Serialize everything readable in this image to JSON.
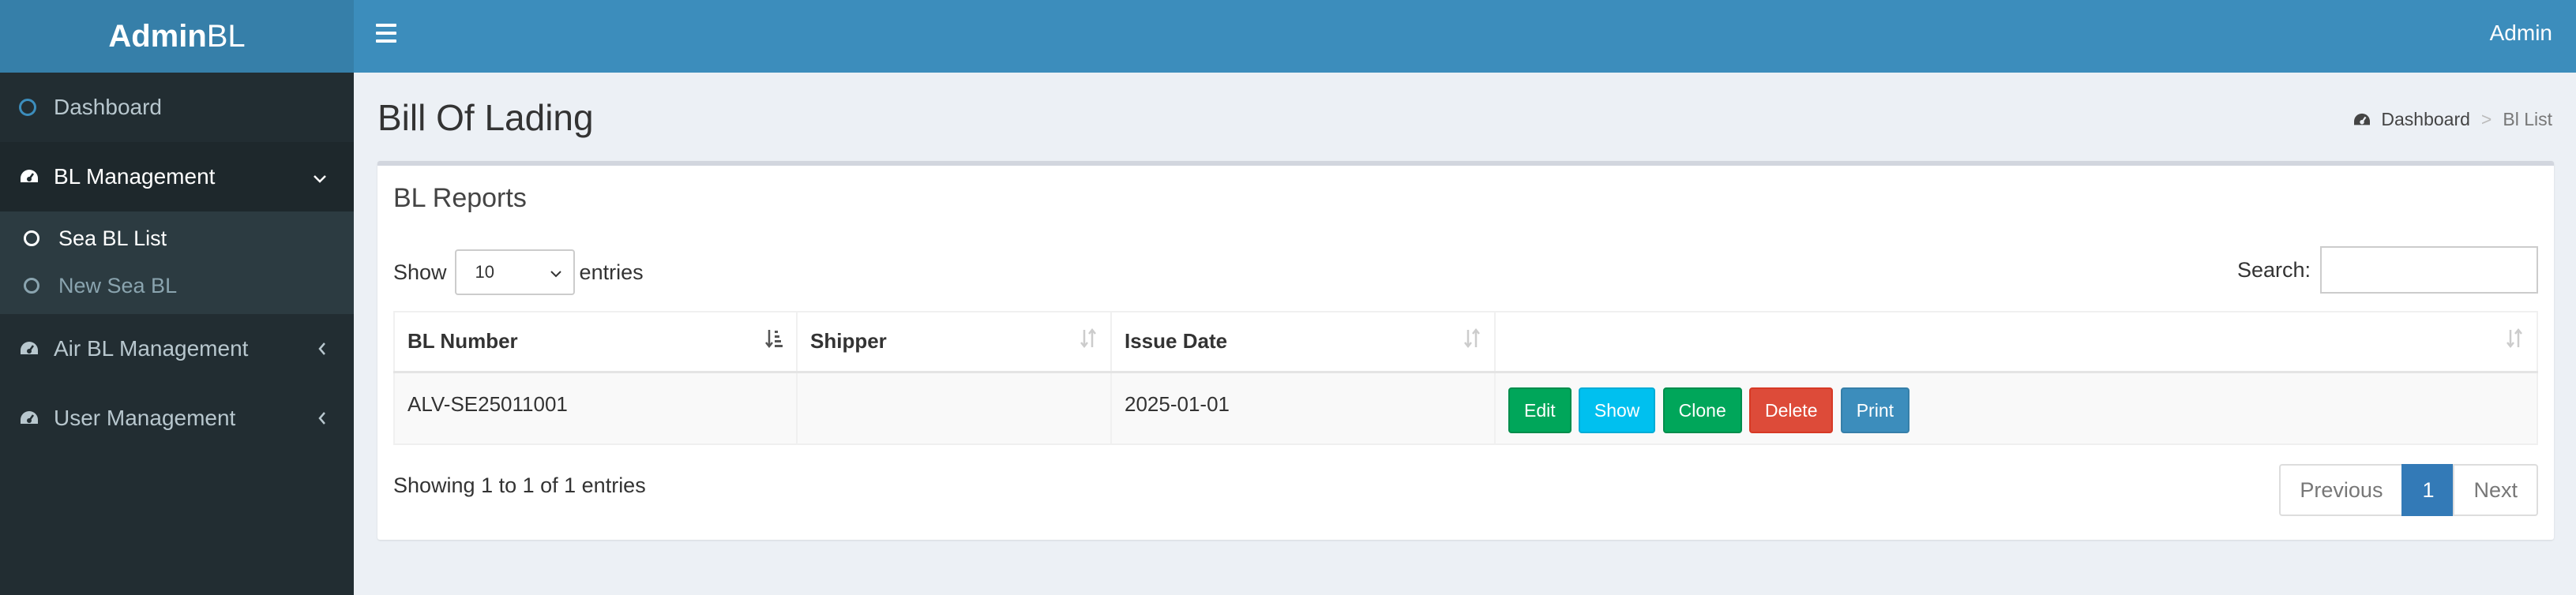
{
  "brand": {
    "bold": "Admin",
    "light": "BL"
  },
  "header": {
    "user": "Admin"
  },
  "sidebar": {
    "items": [
      {
        "label": "Dashboard",
        "icon": "circle-icon"
      },
      {
        "label": "BL Management",
        "icon": "dashboard-icon",
        "expanded": true
      },
      {
        "label": "Air BL Management",
        "icon": "dashboard-icon"
      },
      {
        "label": "User Management",
        "icon": "dashboard-icon"
      }
    ],
    "submenu": [
      {
        "label": "Sea BL List",
        "active": true
      },
      {
        "label": "New Sea BL",
        "active": false
      }
    ]
  },
  "page": {
    "title": "Bill Of Lading",
    "breadcrumb": {
      "home": "Dashboard",
      "separator": ">",
      "current": "Bl List"
    }
  },
  "box": {
    "title": "BL Reports",
    "length": {
      "show": "Show",
      "value": "10",
      "entries": "entries"
    },
    "search_label": "Search:",
    "table": {
      "columns": [
        "BL Number",
        "Shipper",
        "Issue Date",
        ""
      ],
      "rows": [
        {
          "bl_number": "ALV-SE25011001",
          "shipper": "",
          "issue_date": "2025-01-01"
        }
      ],
      "actions": [
        "Edit",
        "Show",
        "Clone",
        "Delete",
        "Print"
      ]
    },
    "info": "Showing 1 to 1 of 1 entries",
    "pagination": {
      "previous": "Previous",
      "current": "1",
      "next": "Next"
    }
  },
  "colors": {
    "header": "#3c8dbc",
    "sidebar": "#222d32",
    "edit": "#00a65a",
    "show": "#00c0ef",
    "clone": "#00a65a",
    "delete": "#dd4b39",
    "print": "#3c8dbc"
  }
}
